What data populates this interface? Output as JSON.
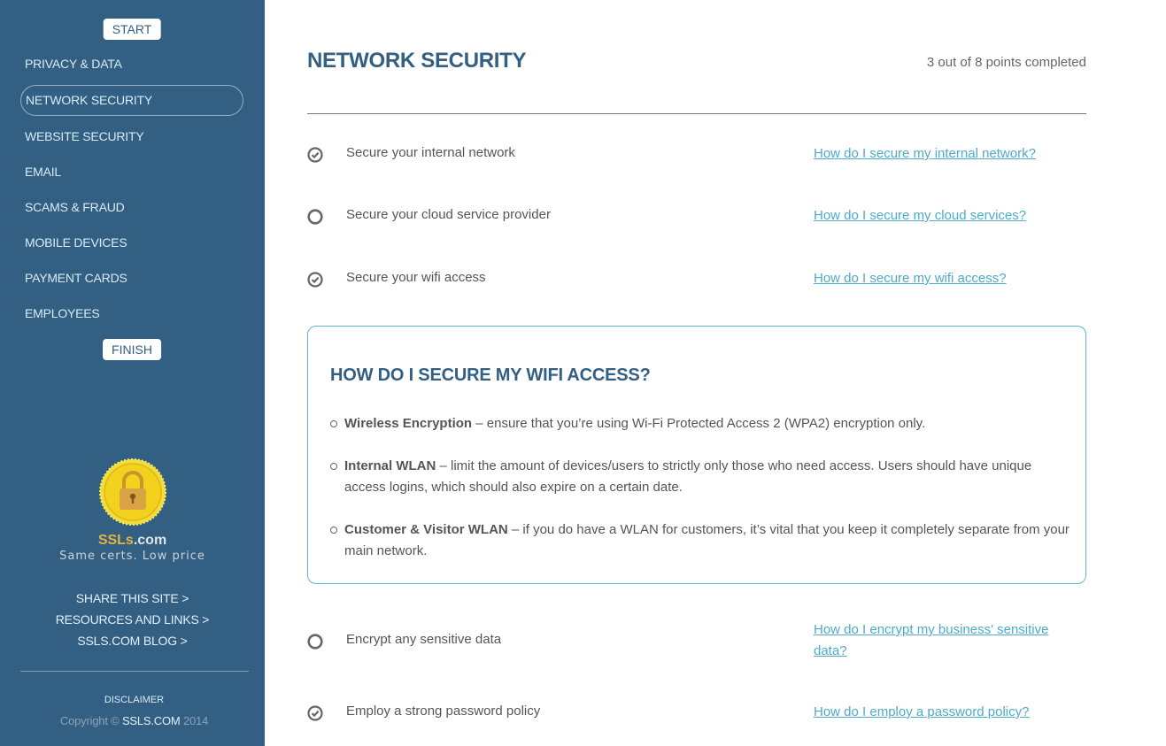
{
  "sidebar": {
    "start_label": "START",
    "finish_label": "FINISH",
    "nav_items": [
      {
        "label": "PRIVACY & DATA",
        "active": false
      },
      {
        "label": "NETWORK SECURITY",
        "active": true
      },
      {
        "label": "WEBSITE SECURITY",
        "active": false
      },
      {
        "label": "EMAIL",
        "active": false
      },
      {
        "label": "SCAMS & FRAUD",
        "active": false
      },
      {
        "label": "MOBILE DEVICES",
        "active": false
      },
      {
        "label": "PAYMENT CARDS",
        "active": false
      },
      {
        "label": "EMPLOYEES",
        "active": false
      }
    ],
    "logo": {
      "icon": "padlock-seal-icon",
      "brand_part1": "SSLs",
      "brand_part2": ".com",
      "tagline": "Same certs. Low price"
    },
    "links": [
      "SHARE THIS SITE >",
      "RESOURCES AND LINKS >",
      "SSLS.COM BLOG >"
    ],
    "disclaimer": "DISCLAIMER",
    "copyright": {
      "prefix": "Copyright © ",
      "link": "SSLS.COM",
      "year": " 2014"
    }
  },
  "main": {
    "title": "NETWORK SECURITY",
    "progress_text": "3 out of 8 points completed",
    "checklist": [
      {
        "label": "Secure your internal network",
        "done": true,
        "link": "How do I secure my internal network?"
      },
      {
        "label": "Secure your cloud service provider",
        "done": false,
        "link": "How do I secure my cloud services?"
      },
      {
        "label": "Secure your wifi access",
        "done": true,
        "link": "How do I secure my wifi access?"
      },
      {
        "label": "Encrypt any sensitive data",
        "done": false,
        "link": "How do I encrypt my business' sensitive data?"
      },
      {
        "label": "Employ a strong password policy",
        "done": true,
        "link": "How do I employ a password policy?"
      }
    ],
    "info_box": {
      "title": "HOW DO I SECURE MY WIFI ACCESS?",
      "items": [
        {
          "term": "Wireless Encryption",
          "text": " – ensure that you’re using Wi-Fi Protected Access 2 (WPA2) encryption only."
        },
        {
          "term": "Internal WLAN",
          "text": " – limit the amount of devices/users to strictly only those who need access. Users should have unique access logins, which should also expire on a certain date."
        },
        {
          "term": "Customer & Visitor WLAN",
          "text": " – if you do have a WLAN for customers, it’s vital that you keep it completely separate from your main network."
        }
      ]
    }
  },
  "colors": {
    "sidebar_bg": "#335f83",
    "accent": "#4eabc9",
    "title": "#335f83",
    "box_border": "#5fb6cc",
    "body_text": "#555555"
  }
}
